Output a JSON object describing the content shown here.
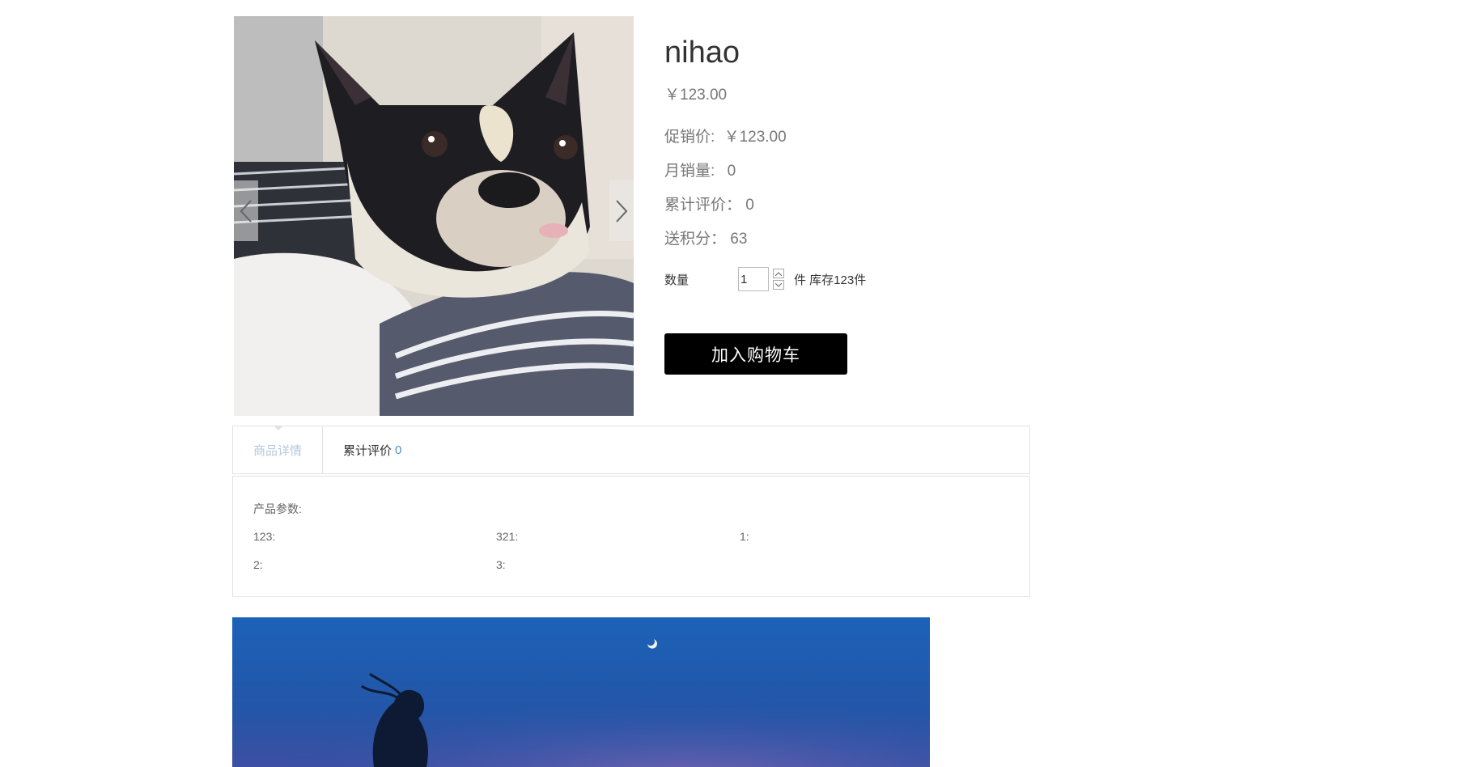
{
  "product": {
    "name": "nihao",
    "price": "￥123.00",
    "promo_label": "促销价:",
    "promo_value": "￥123.00",
    "monthly_sales_label": "月销量:",
    "monthly_sales_value": "0",
    "total_reviews_label": "累计评价：",
    "total_reviews_value": "0",
    "points_label": "送积分：",
    "points_value": "63"
  },
  "quantity": {
    "label": "数量",
    "value": "1",
    "unit_stock": "件 库存123件"
  },
  "cart_button": "加入购物车",
  "tabs": [
    {
      "label": "商品详情",
      "count": ""
    },
    {
      "label": "累计评价",
      "count": "0"
    }
  ],
  "params": {
    "title": "产品参数:",
    "items": [
      "123:",
      "321:",
      "1:",
      "2:",
      "3:"
    ]
  },
  "colors": {
    "button_bg": "#000000",
    "active_tab": "#b5c8dc",
    "count_link": "#4a90c8"
  }
}
